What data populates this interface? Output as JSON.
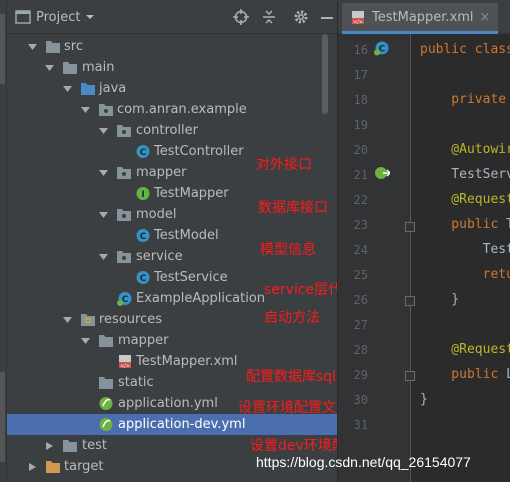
{
  "panel": {
    "title": "Project",
    "dropdown_icon": "chevron-down-icon",
    "actions": [
      "locate-icon",
      "collapse-icon",
      "gear-icon",
      "hide-icon"
    ]
  },
  "tree": [
    {
      "label": "src",
      "icon": "folder",
      "expanded": true
    },
    {
      "label": "main",
      "icon": "folder",
      "expanded": true
    },
    {
      "label": "java",
      "icon": "source-folder",
      "expanded": true
    },
    {
      "label": "com.anran.example",
      "icon": "package",
      "expanded": true
    },
    {
      "label": "controller",
      "icon": "package",
      "expanded": true
    },
    {
      "label": "TestController",
      "icon": "class"
    },
    {
      "label": "mapper",
      "icon": "package",
      "expanded": true
    },
    {
      "label": "TestMapper",
      "icon": "interface"
    },
    {
      "label": "model",
      "icon": "package",
      "expanded": true
    },
    {
      "label": "TestModel",
      "icon": "class"
    },
    {
      "label": "service",
      "icon": "package",
      "expanded": true
    },
    {
      "label": "TestService",
      "icon": "class"
    },
    {
      "label": "ExampleApplication",
      "icon": "spring-class"
    },
    {
      "label": "resources",
      "icon": "resources-folder",
      "expanded": true
    },
    {
      "label": "mapper",
      "icon": "folder",
      "expanded": true
    },
    {
      "label": "TestMapper.xml",
      "icon": "xml-file"
    },
    {
      "label": "static",
      "icon": "folder"
    },
    {
      "label": "application.yml",
      "icon": "spring-yml"
    },
    {
      "label": "application-dev.yml",
      "icon": "spring-yml",
      "selected": true
    },
    {
      "label": "test",
      "icon": "folder",
      "expanded": false
    },
    {
      "label": "target",
      "icon": "excluded-folder",
      "expanded": false
    }
  ],
  "annotations": [
    "对外接口",
    "数据库接口",
    "模型信息",
    "service层代码",
    "启动方法",
    "配置数据库sql",
    "设置环境配置文件",
    "设置dev环境配置"
  ],
  "editor": {
    "tab_label": "TestMapper.xml",
    "tab_close": "×",
    "line_numbers": [
      "16",
      "17",
      "18",
      "19",
      "20",
      "21",
      "22",
      "23",
      "24",
      "25",
      "26",
      "27",
      "28",
      "29",
      "30",
      "31"
    ],
    "code_lines": [
      {
        "parts": [
          {
            "t": "public class",
            "c": "kw"
          }
        ]
      },
      {
        "parts": []
      },
      {
        "parts": [
          {
            "t": "    private",
            "c": "kw"
          }
        ]
      },
      {
        "parts": []
      },
      {
        "parts": [
          {
            "t": "    @Autowir",
            "c": "an"
          }
        ]
      },
      {
        "parts": [
          {
            "t": "    TestServ",
            "c": "tx"
          }
        ]
      },
      {
        "parts": [
          {
            "t": "    @Request",
            "c": "an"
          }
        ]
      },
      {
        "parts": [
          {
            "t": "    public ",
            "c": "kw"
          },
          {
            "t": "T",
            "c": "tx"
          }
        ]
      },
      {
        "parts": [
          {
            "t": "        Test",
            "c": "tx"
          }
        ]
      },
      {
        "parts": [
          {
            "t": "        retu",
            "c": "kw"
          }
        ]
      },
      {
        "parts": [
          {
            "t": "    }",
            "c": "tx"
          }
        ]
      },
      {
        "parts": []
      },
      {
        "parts": [
          {
            "t": "    @Request",
            "c": "an"
          }
        ]
      },
      {
        "parts": [
          {
            "t": "    public ",
            "c": "kw"
          },
          {
            "t": "L",
            "c": "tx"
          }
        ]
      },
      {
        "parts": [
          {
            "t": "}",
            "c": "tx"
          }
        ]
      },
      {
        "parts": []
      }
    ]
  },
  "watermark": "https://blog.csdn.net/qq_26154077",
  "colors": {
    "annotation": "#ff1a1a",
    "selection": "#4b6eaf",
    "keyword": "#cc7832",
    "annotation_code": "#bbb529",
    "text": "#a9b7c6"
  }
}
